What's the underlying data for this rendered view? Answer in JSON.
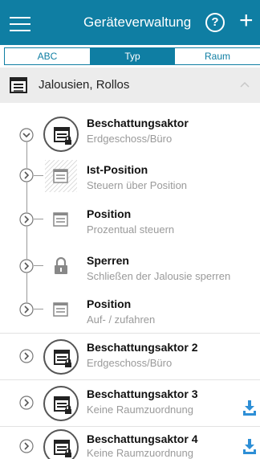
{
  "header": {
    "title": "Geräteverwaltung",
    "help_glyph": "?",
    "add_glyph": "+",
    "bg_color": "#0f7ea3"
  },
  "tabs": [
    {
      "label": "ABC",
      "active": false
    },
    {
      "label": "Typ",
      "active": true
    },
    {
      "label": "Raum",
      "active": false
    }
  ],
  "group": {
    "label": "Jalousien, Rollos",
    "expanded": true
  },
  "actor1": {
    "name": "Beschattungsaktor",
    "location": "Erdgeschoss/Büro",
    "children": [
      {
        "name": "Ist-Position",
        "desc": "Steuern über Position",
        "icon": "blind-hatched-icon"
      },
      {
        "name": "Position",
        "desc": "Prozentual steuern",
        "icon": "blind-icon"
      },
      {
        "name": "Sperren",
        "desc": "Schließen der Jalousie sperren",
        "icon": "lock-icon"
      },
      {
        "name": "Position",
        "desc": "Auf- / zufahren",
        "icon": "blind-icon"
      }
    ]
  },
  "devices": [
    {
      "name": "Beschattungsaktor 2",
      "location": "Erdgeschoss/Büro",
      "download": false
    },
    {
      "name": "Beschattungsaktor 3",
      "location": "Keine Raumzuordnung",
      "download": true
    },
    {
      "name": "Beschattungsaktor 4",
      "location": "Keine Raumzuordnung",
      "download": true
    }
  ],
  "colors": {
    "accent": "#0f7ea3",
    "download": "#2e8fd6"
  }
}
